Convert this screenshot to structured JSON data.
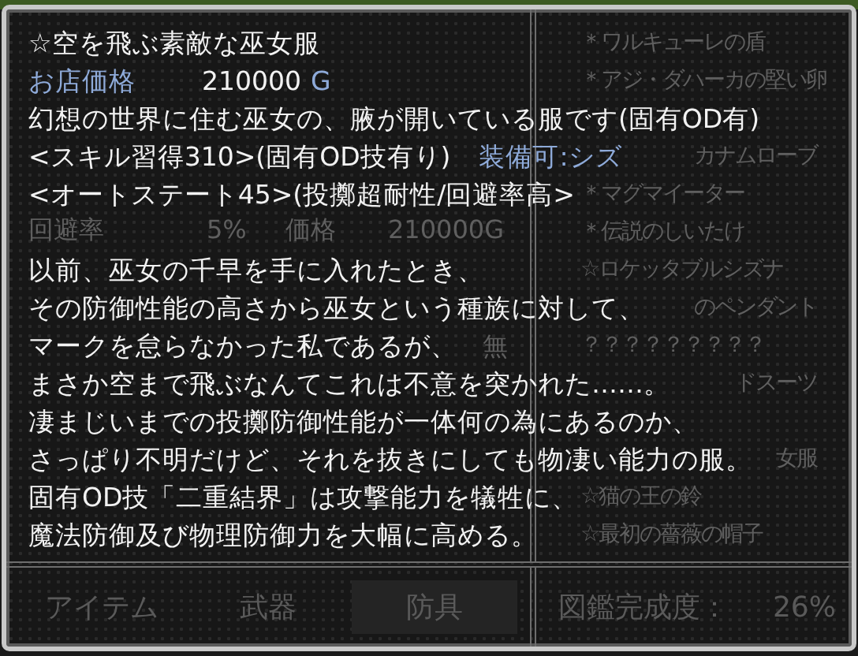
{
  "tooltip": {
    "title": "☆空を飛ぶ素敵な巫女服",
    "price_label": "お店価格",
    "price": "210000",
    "currency": "G",
    "info_lines": [
      [
        {
          "text": "幻想の世界に住む巫女の、腋が開いている服です(固有OD有)",
          "highlight": false
        }
      ],
      [
        {
          "text": "<スキル習得310>(固有OD技有り)",
          "highlight": false
        },
        {
          "text": "装備可:シズ",
          "highlight": true
        }
      ],
      [
        {
          "text": "<オートステート45>(投擲超耐性/回避率高>",
          "highlight": false
        }
      ]
    ],
    "description": [
      "以前、巫女の千早を手に入れたとき、",
      "その防御性能の高さから巫女という種族に対して、",
      "マークを怠らなかった私であるが、",
      "まさか空まで飛ぶなんてこれは不意を突かれた……。",
      "凄まじいまでの投擲防御性能が一体何の為にあるのか、",
      "さっぱり不明だけど、それを抜きにしても物凄い能力の服。",
      "固有OD技「二重結界」は攻撃能力を犠牲に、",
      "魔法防御及び物理防御力を大幅に高める。"
    ]
  },
  "stats": [
    {
      "label": "回避率",
      "value": "5%"
    },
    {
      "label": "価格",
      "value": "210000G"
    }
  ],
  "stat_mark": "無",
  "item_list": [
    [
      {
        "name": "＊ワルキューレの盾",
        "kind": "full"
      },
      {
        "name": "＊アジ・ダハーカの堅い卵",
        "kind": "full"
      }
    ],
    [
      {
        "name": "カナムローブ",
        "kind": "partial"
      },
      {
        "name": "＊マグマイーター",
        "kind": "full"
      },
      {
        "name": "＊伝説のしいたけ",
        "kind": "full"
      },
      {
        "name": "☆ロケッタブルシズナ",
        "kind": "full"
      },
      {
        "name": "のペンダント",
        "kind": "partial"
      },
      {
        "name": "？？？？？？？？？",
        "kind": "full"
      },
      {
        "name": "ドスーツ",
        "kind": "partial"
      }
    ],
    [
      {
        "name": "女服",
        "kind": "partial"
      },
      {
        "name": "☆猫の王の鈴",
        "kind": "full"
      },
      {
        "name": "☆最初の薔薇の帽子",
        "kind": "full"
      }
    ]
  ],
  "tabs": [
    {
      "label": "アイテム",
      "selected": false
    },
    {
      "label": "武器",
      "selected": false
    },
    {
      "label": "防具",
      "selected": true
    }
  ],
  "completion": {
    "label": "図鑑完成度：",
    "value": "26%"
  }
}
